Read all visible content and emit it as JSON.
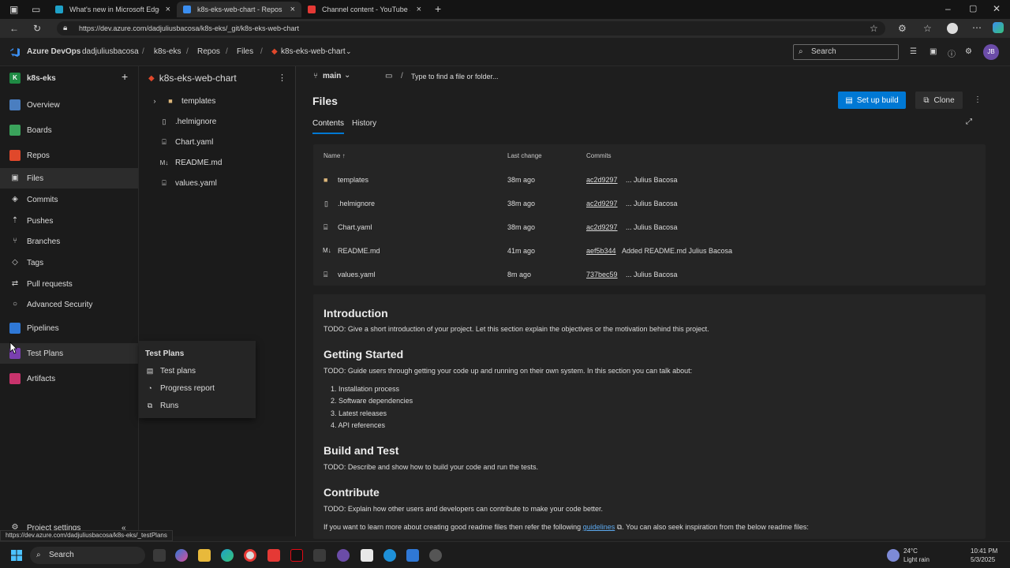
{
  "browser": {
    "tabs": [
      {
        "title": "What's new in Microsoft Edge",
        "fav_color": "#1ea1c8",
        "active": false
      },
      {
        "title": "k8s-eks-web-chart - Repos",
        "fav_color": "#3b8ef0",
        "active": true
      },
      {
        "title": "Channel content - YouTube Studio",
        "fav_color": "#e53935",
        "active": false
      }
    ],
    "url": "https://dev.azure.com/dadjuliusbacosa/k8s-eks/_git/k8s-eks-web-chart"
  },
  "header": {
    "brand": "Azure DevOps",
    "breadcrumbs": [
      "dadjuliusbacosa",
      "k8s-eks",
      "Repos",
      "Files",
      "k8s-eks-web-chart"
    ],
    "search_placeholder": "Search",
    "avatar": "JB",
    "accent": "#0078d4"
  },
  "project": {
    "initial": "K",
    "name": "k8s-eks"
  },
  "leftnav": {
    "items": [
      {
        "label": "Overview",
        "color": "#4a7ec0"
      },
      {
        "label": "Boards",
        "color": "#3aa35b"
      },
      {
        "label": "Repos",
        "color": "#e0482b"
      },
      {
        "label": "Files",
        "sub": true,
        "icon": "▣",
        "selected": true
      },
      {
        "label": "Commits",
        "sub": true,
        "icon": "◈"
      },
      {
        "label": "Pushes",
        "sub": true,
        "icon": "⇡"
      },
      {
        "label": "Branches",
        "sub": true,
        "icon": "⑂"
      },
      {
        "label": "Tags",
        "sub": true,
        "icon": "◇"
      },
      {
        "label": "Pull requests",
        "sub": true,
        "icon": "⇄"
      },
      {
        "label": "Advanced Security",
        "sub": true,
        "icon": "○"
      },
      {
        "label": "Pipelines",
        "color": "#2f78d6"
      },
      {
        "label": "Test Plans",
        "color": "#7a3fb0"
      },
      {
        "label": "Artifacts",
        "color": "#c8336c"
      }
    ],
    "settings": "Project settings"
  },
  "tree": {
    "repo": "k8s-eks-web-chart",
    "items": [
      {
        "name": "templates",
        "type": "folder"
      },
      {
        "name": ".helmignore",
        "type": "file"
      },
      {
        "name": "Chart.yaml",
        "type": "yaml"
      },
      {
        "name": "README.md",
        "type": "md"
      },
      {
        "name": "values.yaml",
        "type": "yaml"
      }
    ]
  },
  "flyout": {
    "title": "Test Plans",
    "items": [
      {
        "label": "Test plans",
        "icon": "▤"
      },
      {
        "label": "Progress report",
        "icon": "◔"
      },
      {
        "label": "Runs",
        "icon": "⧉"
      }
    ]
  },
  "main": {
    "branch": "main",
    "path_placeholder": "Type to find a file or folder...",
    "title": "Files",
    "setup_build": "Set up build",
    "clone": "Clone",
    "tabs": [
      "Contents",
      "History"
    ],
    "columns": [
      "Name ↑",
      "Last change",
      "Commits"
    ],
    "rows": [
      {
        "name": "templates",
        "icon": "folder",
        "changed": "38m ago",
        "commit": "ac2d9297",
        "msg": "... Julius Bacosa"
      },
      {
        "name": ".helmignore",
        "icon": "file",
        "changed": "38m ago",
        "commit": "ac2d9297",
        "msg": "... Julius Bacosa"
      },
      {
        "name": "Chart.yaml",
        "icon": "yaml",
        "changed": "38m ago",
        "commit": "ac2d9297",
        "msg": "... Julius Bacosa"
      },
      {
        "name": "README.md",
        "icon": "md",
        "changed": "41m ago",
        "commit": "aef5b344",
        "msg": "Added README.md Julius Bacosa"
      },
      {
        "name": "values.yaml",
        "icon": "yaml",
        "changed": "8m ago",
        "commit": "737bec59",
        "msg": "... Julius Bacosa"
      }
    ]
  },
  "readme": {
    "intro_h": "Introduction",
    "intro_p": "TODO: Give a short introduction of your project. Let this section explain the objectives or the motivation behind this project.",
    "gs_h": "Getting Started",
    "gs_p": "TODO: Guide users through getting your code up and running on their own system. In this section you can talk about:",
    "gs_list": [
      "Installation process",
      "Software dependencies",
      "Latest releases",
      "API references"
    ],
    "bt_h": "Build and Test",
    "bt_p": "TODO: Describe and show how to build your code and run the tests.",
    "c_h": "Contribute",
    "c_p": "TODO: Explain how other users and developers can contribute to make your code better.",
    "c_p2_a": "If you want to learn more about creating good readme files then refer the following",
    "c_p2_link": "guidelines",
    "c_p2_b": ". You can also seek inspiration from the below readme files:"
  },
  "status_url": "https://dev.azure.com/dadjuliusbacosa/k8s-eks/_testPlans",
  "taskbar": {
    "search": "Search",
    "weather_temp": "24°C",
    "weather_desc": "Light rain",
    "time": "10:41 PM",
    "date": "5/3/2025"
  }
}
